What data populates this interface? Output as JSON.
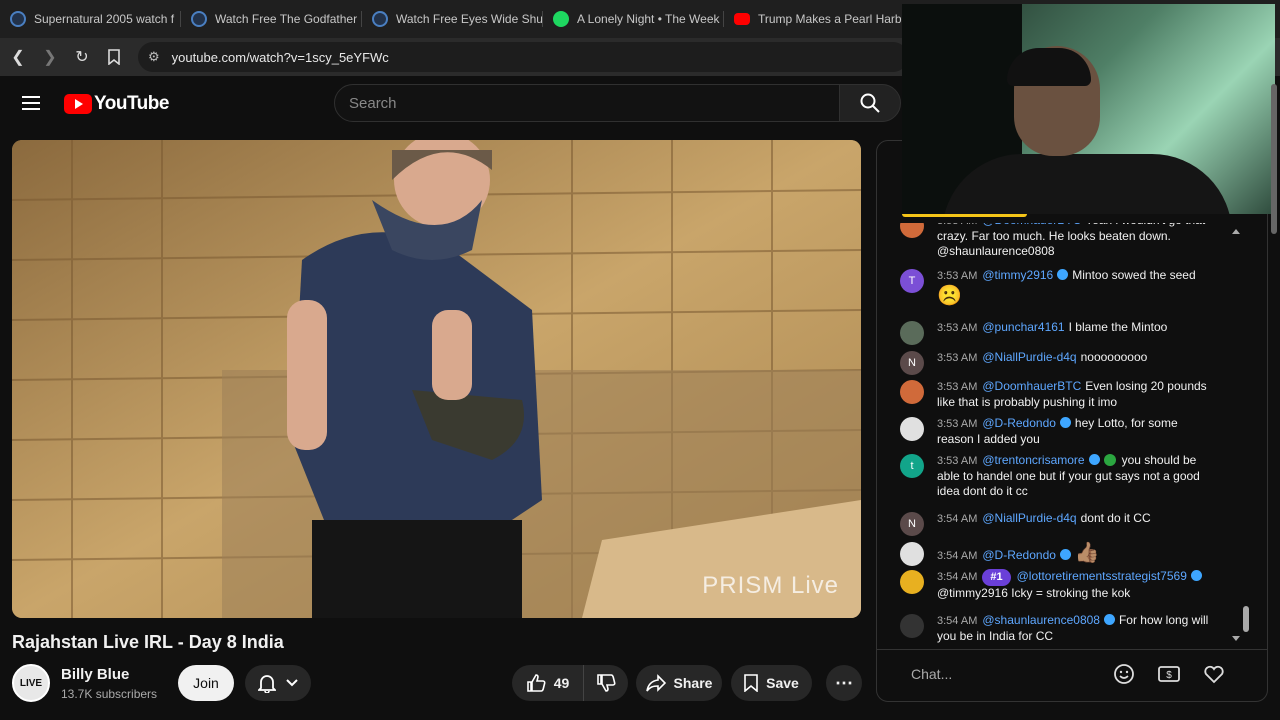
{
  "browser": {
    "tabs": [
      {
        "title": "Supernatural 2005 watch f",
        "icon": "globe-icon"
      },
      {
        "title": "Watch Free The Godfather",
        "icon": "globe-icon"
      },
      {
        "title": "Watch Free Eyes Wide Shu",
        "icon": "globe-icon"
      },
      {
        "title": "A Lonely Night • The Week",
        "icon": "spotify-icon"
      },
      {
        "title": "Trump Makes a Pearl Harb",
        "icon": "youtube-icon"
      }
    ],
    "url": "youtube.com/watch?v=1scy_5eYFWc"
  },
  "youtube": {
    "logo_text": "YouTube",
    "search_placeholder": "Search"
  },
  "video": {
    "watermark": "PRISM Live",
    "title": "Rajahstan Live IRL - Day 8 India"
  },
  "channel": {
    "name": "Billy Blue",
    "subscribers": "13.7K subscribers",
    "avatar_text": "LIVE"
  },
  "actions": {
    "join": "Join",
    "likes": "49",
    "share": "Share",
    "save": "Save"
  },
  "chat": {
    "input_placeholder": "Chat...",
    "messages": [
      {
        "time": "3:53 AM",
        "author": "@DoomhauerBTC",
        "text": "Yeah i wouldn't go that crazy. Far too much. He looks beaten down. @shaunlaurence0808",
        "avatar_color": "#d06a3a",
        "avatar_letter": ""
      },
      {
        "time": "3:53 AM",
        "author": "@timmy2916",
        "verified": true,
        "text": "Mintoo sowed the seed",
        "emoji": "☹️",
        "avatar_color": "#7b4fd6",
        "avatar_letter": "T"
      },
      {
        "time": "3:53 AM",
        "author": "@punchar4161",
        "text": "I blame the Mintoo",
        "avatar_color": "#5a6b5a",
        "avatar_letter": ""
      },
      {
        "time": "3:53 AM",
        "author": "@NiallPurdie-d4q",
        "text": "nooooooooo",
        "avatar_color": "#5b4a4a",
        "avatar_letter": "N"
      },
      {
        "time": "3:53 AM",
        "author": "@DoomhauerBTC",
        "text": "Even losing 20 pounds like that is probably pushing it imo",
        "avatar_color": "#d06a3a",
        "avatar_letter": ""
      },
      {
        "time": "3:53 AM",
        "author": "@D-Redondo",
        "verified": true,
        "text": "hey Lotto, for some reason I added you",
        "avatar_color": "#e0e0e0",
        "avatar_letter": ""
      },
      {
        "time": "3:53 AM",
        "author": "@trentoncrisamore",
        "verified": true,
        "moderator": true,
        "text": "you should be able to handel one but if your gut says not a good idea dont do it cc",
        "avatar_color": "#12a58a",
        "avatar_letter": "t"
      },
      {
        "time": "3:54 AM",
        "author": "@NiallPurdie-d4q",
        "text": "dont do it CC",
        "avatar_color": "#5b4a4a",
        "avatar_letter": "N"
      },
      {
        "time": "3:54 AM",
        "author": "@D-Redondo",
        "verified": true,
        "text": "",
        "emoji": "👍🏽",
        "avatar_color": "#e0e0e0",
        "avatar_letter": ""
      },
      {
        "time": "3:54 AM",
        "author": "@lottoretirementsstrategist7569",
        "verified": true,
        "badge": "#1",
        "text": "@timmy2916 Icky = stroking the kok",
        "avatar_color": "#e8b020",
        "avatar_letter": ""
      },
      {
        "time": "3:54 AM",
        "author": "@shaunlaurence0808",
        "verified": true,
        "text": "For how long will you be in India for CC",
        "avatar_color": "#333333",
        "avatar_letter": ""
      }
    ]
  },
  "colors": {
    "background": "#0f0f0f",
    "author_link": "#5ea7ff",
    "youtube_red": "#ff0000",
    "chat_badge": "#6a3fd8"
  }
}
